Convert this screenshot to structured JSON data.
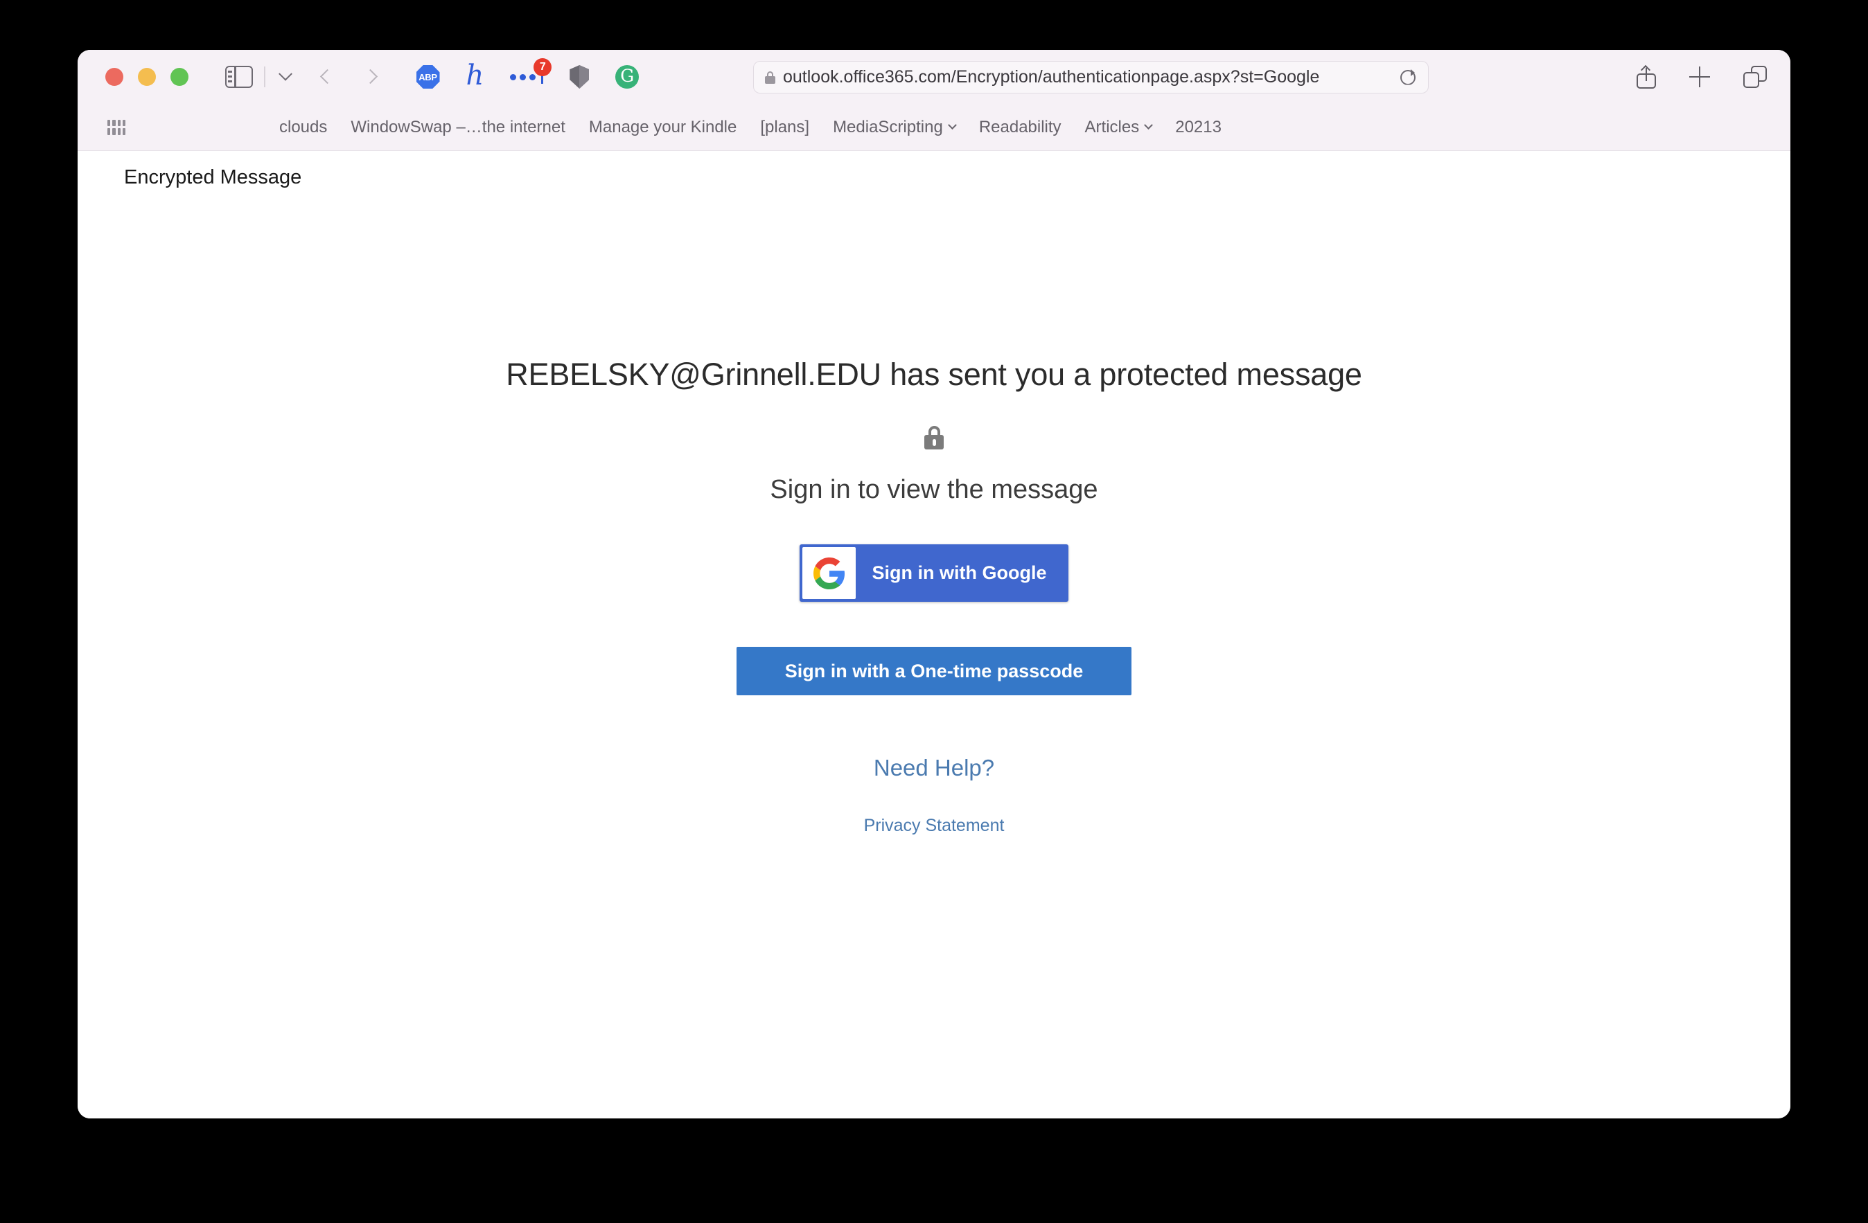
{
  "browser": {
    "window_controls": [
      "close",
      "minimize",
      "maximize"
    ],
    "url": "outlook.office365.com/Encryption/authenticationpage.aspx?st=Google",
    "extensions": [
      {
        "name": "adblock-plus",
        "label": "ABP"
      },
      {
        "name": "honey",
        "label": "h"
      },
      {
        "name": "password-manager",
        "label": "",
        "badge": "7"
      },
      {
        "name": "privacy-shield",
        "label": ""
      },
      {
        "name": "grammarly",
        "label": "G"
      }
    ],
    "bookmarks": [
      {
        "label": "clouds",
        "has_menu": false
      },
      {
        "label": "WindowSwap –…the internet",
        "has_menu": false
      },
      {
        "label": "Manage your Kindle",
        "has_menu": false
      },
      {
        "label": "[plans]",
        "has_menu": false
      },
      {
        "label": "MediaScripting",
        "has_menu": true
      },
      {
        "label": "Readability",
        "has_menu": false
      },
      {
        "label": "Articles",
        "has_menu": true
      },
      {
        "label": "20213",
        "has_menu": false
      }
    ]
  },
  "page": {
    "title": "Encrypted Message",
    "headline": "REBELSKY@Grinnell.EDU has sent you a protected message",
    "subhead": "Sign in to view the message",
    "google_button": "Sign in with Google",
    "google_logo_letter": "G",
    "otp_button": "Sign in with a One-time passcode",
    "need_help": "Need Help?",
    "privacy": "Privacy Statement"
  },
  "colors": {
    "google_blue": "#4067ce",
    "otp_blue": "#3578c8",
    "link_blue": "#4a7aaf",
    "toolbar_bg": "#f6f1f6",
    "badge_red": "#e8392b"
  }
}
